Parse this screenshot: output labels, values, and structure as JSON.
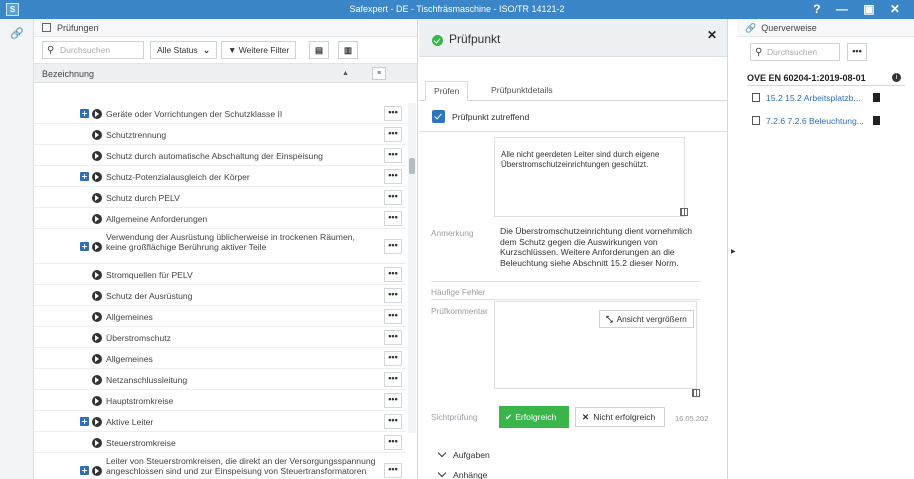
{
  "window": {
    "title": "Safexpert - DE - Tischfräsmaschine - ISO/TR 14121-2",
    "controls": "? — ▣ ✕"
  },
  "left_panel": {
    "header": "Prüfungen",
    "search_placeholder": "Durchsuchen",
    "status_filter": "Alle Status",
    "more_filters": "Weitere Filter",
    "column_header": "Bezeichnung",
    "rows": [
      {
        "label": "Geräte oder Vorrichtungen der Schutzklasse II",
        "expandable": true
      },
      {
        "label": "Schutztrennung",
        "expandable": false
      },
      {
        "label": "Schutz durch automatische Abschaltung der Einspeisung",
        "expandable": false
      },
      {
        "label": "Schutz-Potenzialausgleich der Körper",
        "expandable": true
      },
      {
        "label": "Schutz durch PELV",
        "expandable": false
      },
      {
        "label": "Allgemeine Anforderungen",
        "expandable": false
      },
      {
        "label": "Verwendung der Ausrüstung üblicherweise in trockenen Räumen, keine großflächige Berührung aktiver Teile",
        "expandable": true
      },
      {
        "label": "Stromquellen für PELV",
        "expandable": false
      },
      {
        "label": "Schutz der Ausrüstung",
        "expandable": false
      },
      {
        "label": "Allgemeines",
        "expandable": false
      },
      {
        "label": "Überstromschutz",
        "expandable": false
      },
      {
        "label": "Allgemeines",
        "expandable": false
      },
      {
        "label": "Netzanschlussleitung",
        "expandable": false
      },
      {
        "label": "Hauptstromkreise",
        "expandable": false
      },
      {
        "label": "Aktive Leiter",
        "expandable": true
      },
      {
        "label": "Steuerstromkreise",
        "expandable": false
      },
      {
        "label": "Leiter von Steuerstromkreisen, die direkt an der Versorgungsspannung angeschlossen sind und zur Einspeisung von Steuertransformatoren",
        "expandable": true
      }
    ],
    "more_label": "•••"
  },
  "detail": {
    "title": "Prüfpunkt",
    "close": "✕",
    "tabs": [
      "Prüfen",
      "Prüfpunktdetails"
    ],
    "checkbox_label": "Prüfpunkt zutreffend",
    "requirement_text": "Alle nicht geerdeten Leiter sind durch eigene Überstromschutzeinrichtungen geschützt.",
    "remark_label": "Anmerkung",
    "remark_text": "Die Überstromschutzeinrichtung dient vornehmlich dem Schutz gegen die Auswirkungen von Kurzschlüssen. Weitere Anforderungen an die Beleuchtung siehe Abschnitt 15.2 dieser Norm.",
    "common_errors_label": "Häufige Fehler",
    "comment_label": "Prüfkommentar",
    "enlarge_button": "Ansicht vergrößern",
    "visual_check_label": "Sichtprüfung",
    "success_button": "Erfolgreich",
    "fail_button": "Nicht erfolgreich",
    "date": "16.05.202",
    "accordions": [
      "Aufgaben",
      "Anhänge"
    ]
  },
  "right_panel": {
    "header": "Querverweise",
    "search_placeholder": "Durchsuchen",
    "more": "•••",
    "norm": "OVE EN 60204-1:2019-08-01",
    "info": "i",
    "refs": [
      "15.2 15.2 Arbeitsplatzb...",
      "7.2.6 7.2.6 Beleuchtung..."
    ]
  },
  "colors": {
    "titlebar": "#3a86c8",
    "success": "#3ab54a",
    "accent": "#2f74c0"
  }
}
